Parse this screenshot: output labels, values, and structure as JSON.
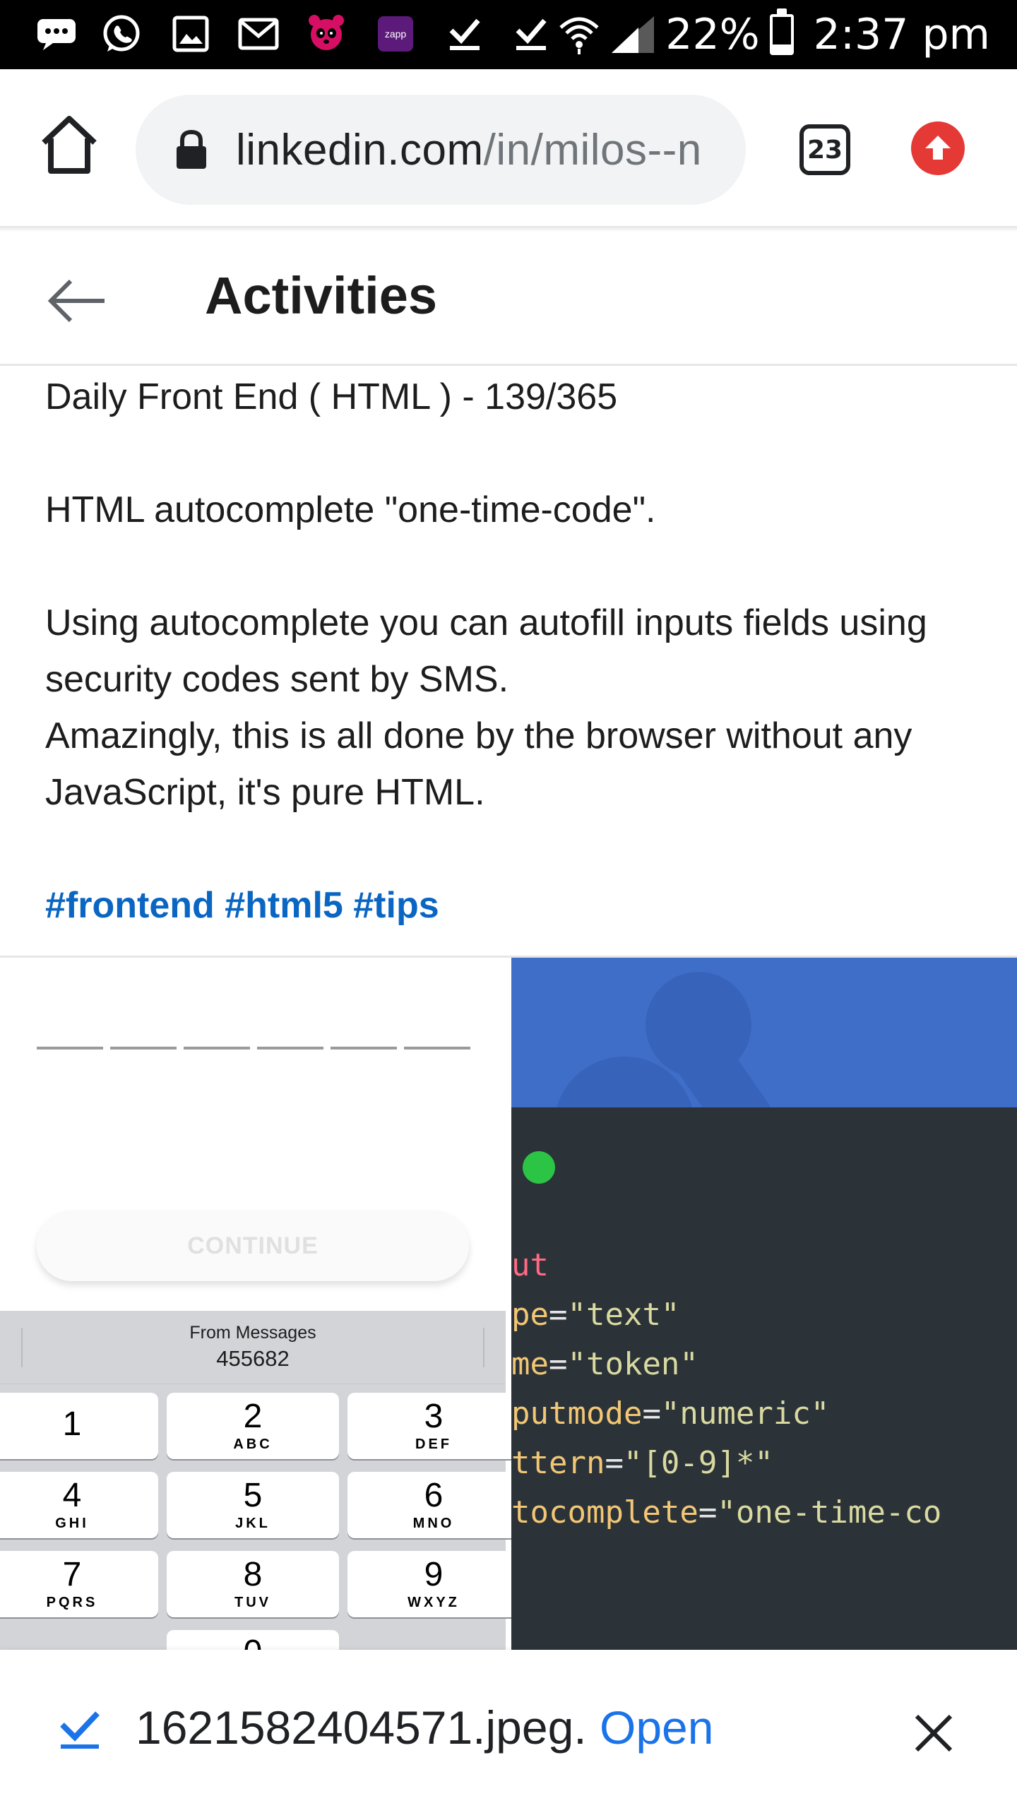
{
  "status_bar": {
    "battery": "22%",
    "time": "2:37 pm",
    "notification_icons": [
      "chat-bubble-icon",
      "whatsapp-icon",
      "gallery-icon",
      "gmail-icon",
      "foodpanda-icon",
      "zapp-icon",
      "download-done-icon",
      "download-done-icon"
    ],
    "zapp_label": "zapp"
  },
  "browser": {
    "url_host": "linkedin.com",
    "url_path": "/in/milos--n",
    "tab_count": "23"
  },
  "page": {
    "title": "Activities"
  },
  "post": {
    "line1": "Daily Front End ( HTML ) - 139/365",
    "line2": "HTML autocomplete \"one-time-code\".",
    "line3": "Using autocomplete you can autofill inputs fields using security codes sent by SMS.",
    "line4": "Amazingly, this is all done by the browser without any JavaScript, it's pure HTML.",
    "hashtags": "#frontend #html5 #tips"
  },
  "post_image": {
    "continue_label": "CONTINUE",
    "suggestion_title": "From Messages",
    "suggestion_code": "455682",
    "keys": [
      {
        "num": "1",
        "letters": ""
      },
      {
        "num": "2",
        "letters": "ABC"
      },
      {
        "num": "3",
        "letters": "DEF"
      },
      {
        "num": "4",
        "letters": "GHI"
      },
      {
        "num": "5",
        "letters": "JKL"
      },
      {
        "num": "6",
        "letters": "MNO"
      },
      {
        "num": "7",
        "letters": "PQRS"
      },
      {
        "num": "8",
        "letters": "TUV"
      },
      {
        "num": "9",
        "letters": "WXYZ"
      }
    ],
    "partial_key": "0",
    "code": {
      "tag": "ut",
      "l1_attr": "pe",
      "l1_val": "\"text\"",
      "l2_attr": "me",
      "l2_val": "\"token\"",
      "l3_attr": "putmode",
      "l3_val": "\"numeric\"",
      "l4_attr": "ttern",
      "l4_val": "\"[0-9]*\"",
      "l5_attr": "tocomplete",
      "l5_val": "\"one-time-co"
    }
  },
  "download": {
    "filename": "1621582404571.jpeg.",
    "open_label": "Open"
  },
  "colors": {
    "link": "#0a66c2",
    "open_link": "#1a73e8",
    "update_badge": "#e53935",
    "code_bg": "#2b3339",
    "banner": "#3f6ec9",
    "green_dot": "#2bc445"
  }
}
